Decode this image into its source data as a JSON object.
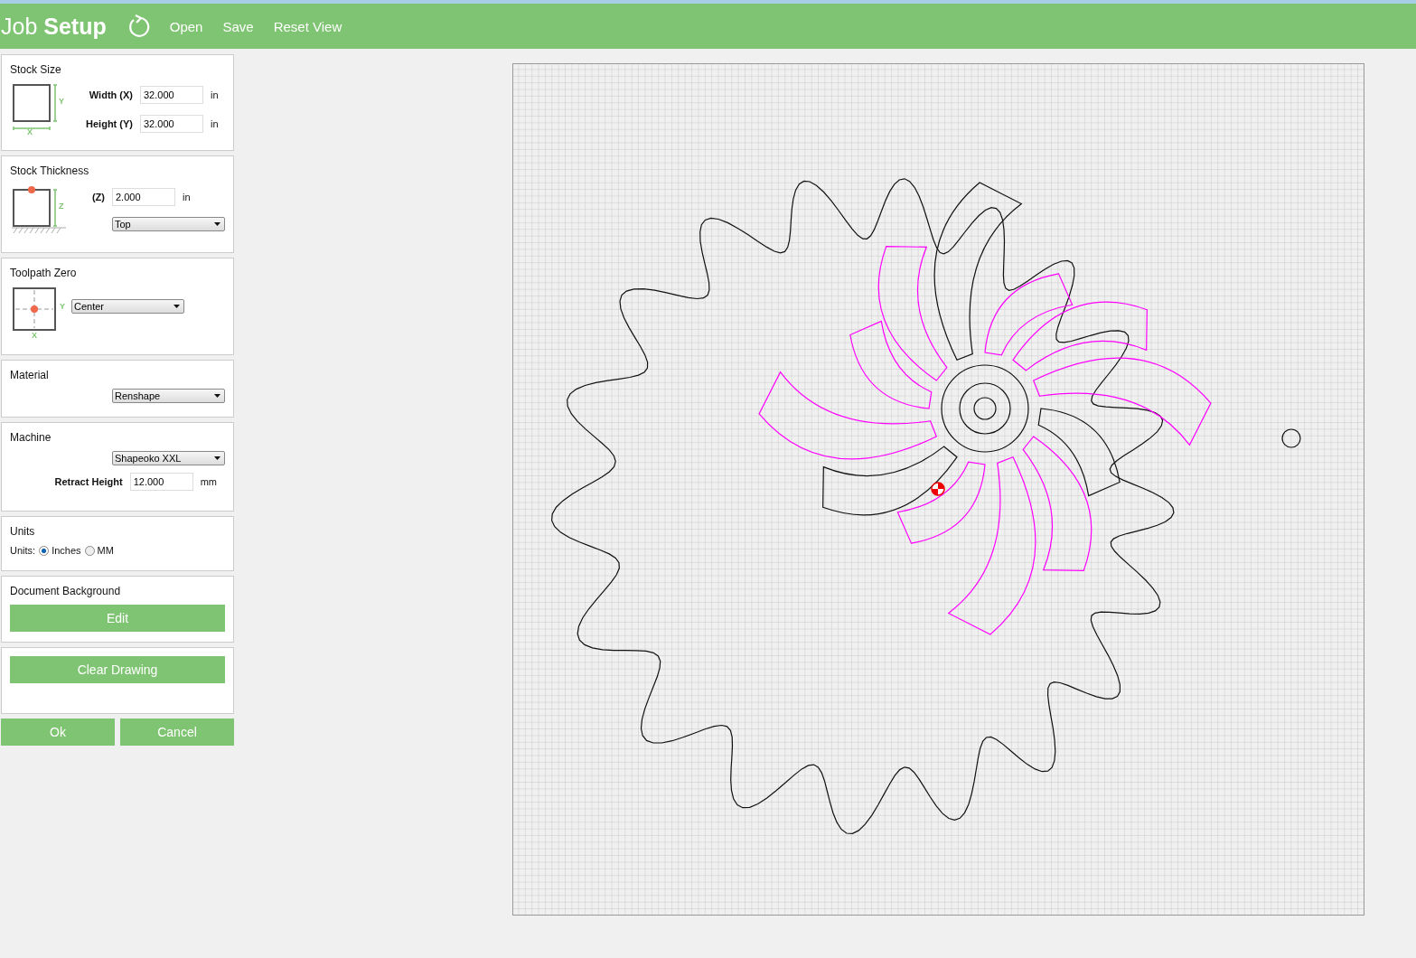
{
  "header": {
    "title_light": "Job",
    "title_bold": "Setup",
    "menu": [
      "Open",
      "Save",
      "Reset View"
    ]
  },
  "stock_size": {
    "title": "Stock Size",
    "axis_x": "X",
    "axis_y": "Y",
    "fields": [
      {
        "label": "Width (X)",
        "value": "32.000",
        "unit": "in"
      },
      {
        "label": "Height (Y)",
        "value": "32.000",
        "unit": "in"
      }
    ]
  },
  "stock_thickness": {
    "title": "Stock Thickness",
    "axis_z": "Z",
    "field": {
      "label": "(Z)",
      "value": "2.000",
      "unit": "in"
    },
    "dropdown": "Top"
  },
  "toolpath_zero": {
    "title": "Toolpath Zero",
    "axis_x": "X",
    "axis_y": "Y",
    "dropdown": "Center"
  },
  "material": {
    "title": "Material",
    "dropdown": "Renshape"
  },
  "machine": {
    "title": "Machine",
    "dropdown": "Shapeoko XXL",
    "field": {
      "label": "Retract Height",
      "value": "12.000",
      "unit": "mm"
    }
  },
  "units": {
    "title": "Units",
    "prefix": "Units:",
    "options": [
      {
        "label": "Inches",
        "selected": true
      },
      {
        "label": "MM",
        "selected": false
      }
    ]
  },
  "document_background": {
    "title": "Document Background",
    "button": "Edit"
  },
  "clear": {
    "button": "Clear Drawing"
  },
  "actions": [
    "Ok",
    "Cancel"
  ]
}
